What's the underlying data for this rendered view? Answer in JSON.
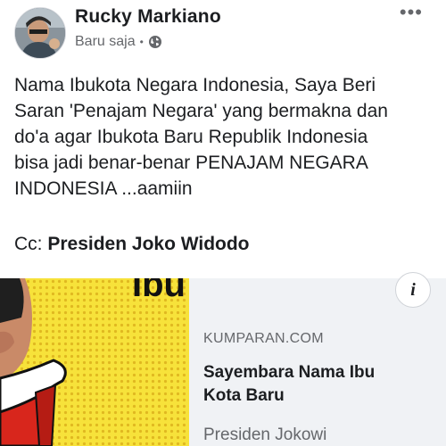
{
  "post": {
    "author": "Rucky Markiano",
    "timestamp": "Baru saja",
    "privacy_icon": "globe-icon",
    "more_icon": "more-horizontal-icon",
    "text_lines": [
      "Nama Ibukota Negara Indonesia, Saya Beri",
      "Saran 'Penajam Negara' yang bermakna dan",
      "do'a agar Ibukota Baru Republik Indonesia",
      "bisa jadi benar-benar PENAJAM NEGARA",
      "INDONESIA ...aamiin"
    ],
    "cc_prefix": "Cc: ",
    "cc_name": "Presiden Joko Widodo"
  },
  "link": {
    "domain": "KUMPARAN.COM",
    "title_lines": [
      "Sayembara Nama Ibu",
      "Kota Baru"
    ],
    "description": "Presiden Jokowi",
    "info_label": "i",
    "thumbnail_text": "Ibu"
  },
  "colors": {
    "text": "#1c1e21",
    "secondary": "#65676b",
    "card_bg": "#f0f2f5",
    "thumb_yellow": "#f7e23a",
    "thumb_red": "#d8261c"
  }
}
